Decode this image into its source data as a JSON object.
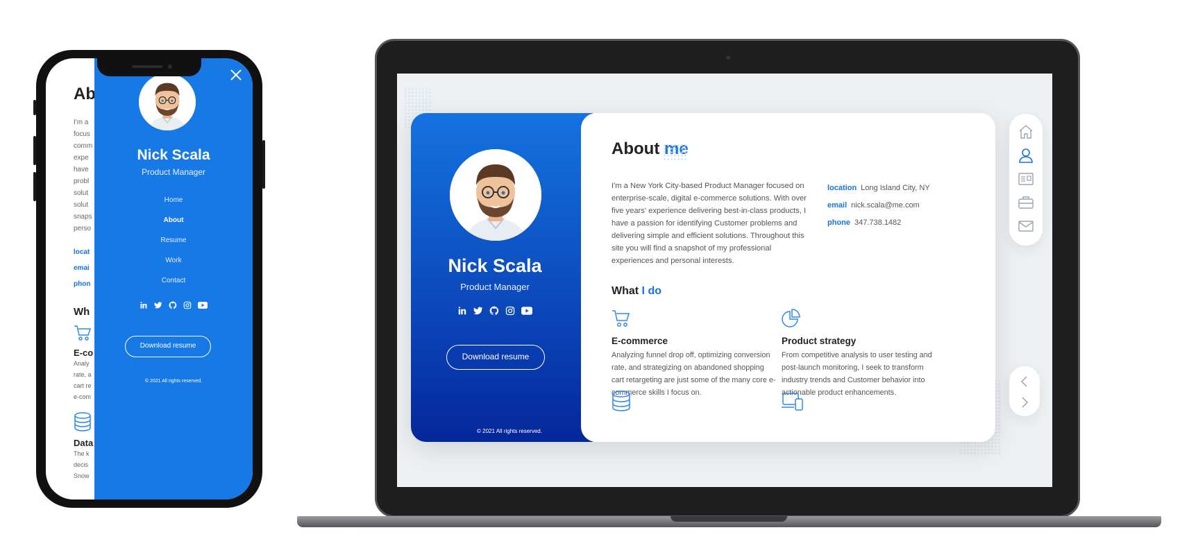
{
  "profile": {
    "name": "Nick Scala",
    "title": "Product Manager",
    "download_label": "Download resume",
    "copyright": "© 2021 All rights reserved."
  },
  "social": [
    "linkedin-icon",
    "twitter-icon",
    "github-icon",
    "instagram-icon",
    "youtube-icon"
  ],
  "mobile_nav": [
    "Home",
    "About",
    "Resume",
    "Work",
    "Contact"
  ],
  "mobile_active": "About",
  "mobile_page": {
    "title": "Ab",
    "lines": [
      "I'm a",
      "focus",
      "comm",
      "expe",
      "have",
      "probl",
      "solut",
      "solut",
      "snaps",
      "perso"
    ],
    "info": [
      "locat",
      "emai",
      "phon"
    ],
    "what": "Wh",
    "service1": "E-co",
    "service1_lines": [
      "Analy",
      "rate, a",
      "cart re",
      "e-com"
    ],
    "service2": "Data",
    "service2_lines": [
      "The k",
      "decis",
      "Snow"
    ]
  },
  "about": {
    "title_a": "About ",
    "title_b": "me",
    "body": "I'm a New York City-based Product Manager focused on enterprise-scale, digital e-commerce solutions. With over five years' experience delivering best-in-class products, I have a passion for identifying Customer problems and delivering simple and efficient solutions. Throughout this site you will find a snapshot of my professional experiences and personal interests.",
    "location_label": "location",
    "location": "Long Island City, NY",
    "email_label": "email",
    "email": "nick.scala@me.com",
    "phone_label": "phone",
    "phone": "347.738.1482"
  },
  "what": {
    "title_a": "What ",
    "title_b": "I do",
    "services": [
      {
        "title": "E-commerce",
        "text": "Analyzing funnel drop off, optimizing conversion rate, and strategizing on abandoned shopping cart retargeting are just some of the many core e-commerce skills I focus on.",
        "icon": "shopping-cart-icon"
      },
      {
        "title": "Product strategy",
        "text": "From competitive analysis to user testing and post-launch monitoring, I seek to transform industry trends and Customer behavior into actionable product enhancements.",
        "icon": "pie-chart-icon"
      }
    ]
  },
  "right_nav": [
    "home-icon",
    "user-icon",
    "resume-icon",
    "briefcase-icon",
    "mail-icon"
  ],
  "colors": {
    "accent": "#1773e0",
    "sidebar_top": "#1572e0",
    "sidebar_bottom": "#05279a"
  }
}
